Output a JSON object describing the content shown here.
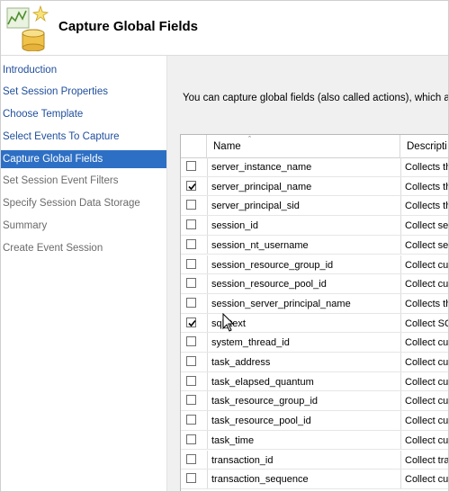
{
  "window": {
    "title": "Capture Global Fields",
    "logo_icon": "database-wizard-icon"
  },
  "sidebar": {
    "items": [
      {
        "label": "Introduction",
        "state": "link"
      },
      {
        "label": "Set Session Properties",
        "state": "link"
      },
      {
        "label": "Choose Template",
        "state": "link"
      },
      {
        "label": "Select Events To Capture",
        "state": "link"
      },
      {
        "label": "Capture Global Fields",
        "state": "active"
      },
      {
        "label": "Set Session Event Filters",
        "state": "disabled"
      },
      {
        "label": "Specify Session Data Storage",
        "state": "disabled"
      },
      {
        "label": "Summary",
        "state": "disabled"
      },
      {
        "label": "Create Event Session",
        "state": "disabled"
      }
    ]
  },
  "main": {
    "description": "You can capture global fields (also called actions), which are co",
    "grid": {
      "columns": {
        "name": "Name",
        "description": "Descripti"
      },
      "sort_indicator": "ascending",
      "rows": [
        {
          "checked": false,
          "name": "server_instance_name",
          "description": "Collects th"
        },
        {
          "checked": true,
          "name": "server_principal_name",
          "description": "Collects th"
        },
        {
          "checked": false,
          "name": "server_principal_sid",
          "description": "Collects th"
        },
        {
          "checked": false,
          "name": "session_id",
          "description": "Collect ses"
        },
        {
          "checked": false,
          "name": "session_nt_username",
          "description": "Collect ses"
        },
        {
          "checked": false,
          "name": "session_resource_group_id",
          "description": "Collect cu"
        },
        {
          "checked": false,
          "name": "session_resource_pool_id",
          "description": "Collect cu"
        },
        {
          "checked": false,
          "name": "session_server_principal_name",
          "description": "Collects th"
        },
        {
          "checked": true,
          "name": "sql_text",
          "description": "Collect SQ"
        },
        {
          "checked": false,
          "name": "system_thread_id",
          "description": "Collect cu"
        },
        {
          "checked": false,
          "name": "task_address",
          "description": "Collect cu"
        },
        {
          "checked": false,
          "name": "task_elapsed_quantum",
          "description": "Collect cu"
        },
        {
          "checked": false,
          "name": "task_resource_group_id",
          "description": "Collect cu"
        },
        {
          "checked": false,
          "name": "task_resource_pool_id",
          "description": "Collect cu"
        },
        {
          "checked": false,
          "name": "task_time",
          "description": "Collect cu"
        },
        {
          "checked": false,
          "name": "transaction_id",
          "description": "Collect tra"
        },
        {
          "checked": false,
          "name": "transaction_sequence",
          "description": "Collect cu"
        }
      ]
    }
  },
  "colors": {
    "active_bg": "#2d6fc4",
    "link": "#1f4e9c",
    "disabled": "#6b6b6b",
    "panel_bg": "#f0f0f0"
  }
}
